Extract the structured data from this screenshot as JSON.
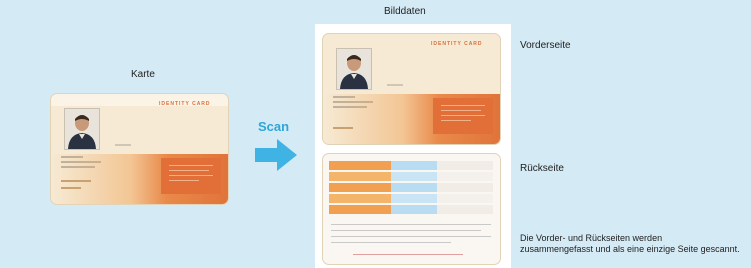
{
  "labels": {
    "card": "Karte",
    "scan": "Scan",
    "image_data": "Bilddaten",
    "front": "Vorderseite",
    "back": "Rückseite",
    "note_line1": "Die Vorder- und Rückseiten werden",
    "note_line2": "zusammengefasst und als eine einzige Seite gescannt."
  },
  "card_title": "IDENTITY CARD",
  "colors": {
    "background": "#d4eaf5",
    "arrow": "#3fb4e4",
    "card_orange": "#e98a4a",
    "card_cream": "#f6ead4",
    "table_orange": "#f0a050",
    "table_blue": "#b8dcf2"
  }
}
